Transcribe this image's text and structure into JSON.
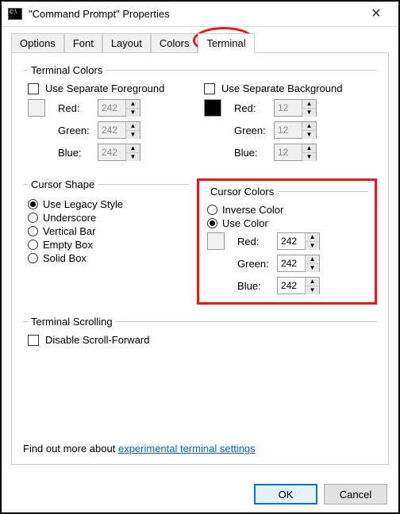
{
  "window": {
    "title": "\"Command Prompt\" Properties"
  },
  "tabs": {
    "options": "Options",
    "font": "Font",
    "layout": "Layout",
    "colors": "Colors",
    "terminal": "Terminal"
  },
  "terminalColors": {
    "legend": "Terminal Colors",
    "useSeparateFg": "Use Separate Foreground",
    "useSeparateBg": "Use Separate Background",
    "redLabel": "Red:",
    "greenLabel": "Green:",
    "blueLabel": "Blue:",
    "fg": {
      "r": "242",
      "g": "242",
      "b": "242"
    },
    "bg": {
      "r": "12",
      "g": "12",
      "b": "12"
    }
  },
  "cursorShape": {
    "legend": "Cursor Shape",
    "legacy": "Use Legacy Style",
    "underscore": "Underscore",
    "vbar": "Vertical Bar",
    "empty": "Empty Box",
    "solid": "Solid Box"
  },
  "cursorColors": {
    "legend": "Cursor Colors",
    "inverse": "Inverse Color",
    "useColor": "Use Color",
    "redLabel": "Red:",
    "greenLabel": "Green:",
    "blueLabel": "Blue:",
    "r": "242",
    "g": "242",
    "b": "242"
  },
  "scrolling": {
    "legend": "Terminal Scrolling",
    "disable": "Disable Scroll-Forward"
  },
  "help": {
    "prefix": "Find out more about ",
    "link": "experimental terminal settings"
  },
  "buttons": {
    "ok": "OK",
    "cancel": "Cancel"
  }
}
